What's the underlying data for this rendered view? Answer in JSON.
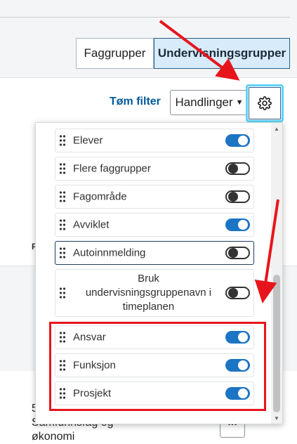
{
  "tabs": {
    "faggrupper": "Faggrupper",
    "undervisningsgrupper": "Undervisningsgrupper"
  },
  "toolbar": {
    "clear_filter": "Tøm filter",
    "actions": "Handlinger",
    "actions_caret": "▼",
    "settings_icon": "gear-icon"
  },
  "background": {
    "fragment_letter": "F",
    "row_text_line1": "5",
    "row_text_line2": "Samfunnsfag og",
    "row_text_line3": "økonomi",
    "more_label": "..."
  },
  "columns_menu": {
    "items": [
      {
        "label": "Elever",
        "enabled": true
      },
      {
        "label": "Flere faggrupper",
        "enabled": false
      },
      {
        "label": "Fagområde",
        "enabled": false
      },
      {
        "label": "Avviklet",
        "enabled": true
      },
      {
        "label": "Autoinnmelding",
        "enabled": false
      },
      {
        "label": "Bruk undervisningsgruppenavn i timeplanen",
        "label_lines": [
          "Bruk",
          "undervisningsgruppenavn i",
          "timeplanen"
        ],
        "enabled": false
      },
      {
        "label": "Ansvar",
        "enabled": true
      },
      {
        "label": "Funksjon",
        "enabled": true
      },
      {
        "label": "Prosjekt",
        "enabled": true
      }
    ]
  },
  "colors": {
    "accent": "#1c74c4",
    "highlight": "#e8141c",
    "focus_ring": "#5fd3f7"
  }
}
